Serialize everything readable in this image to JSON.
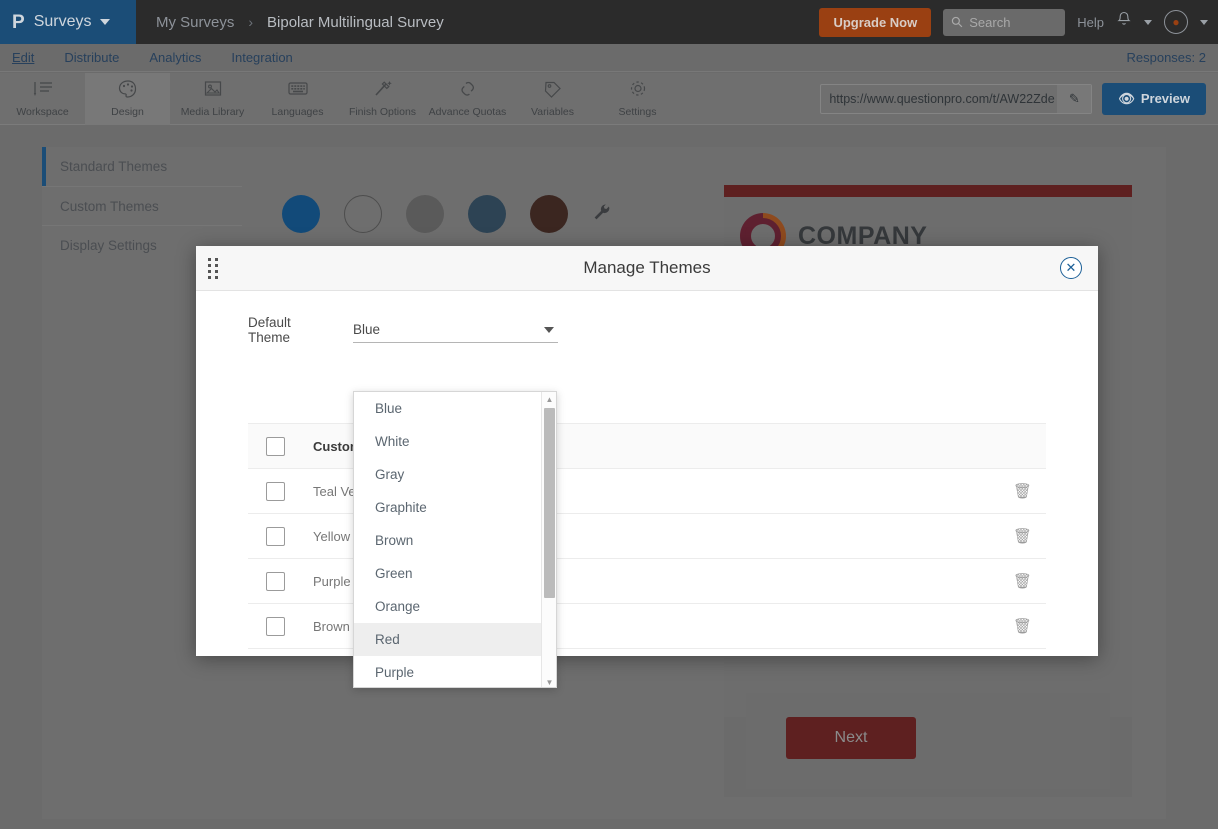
{
  "topbar": {
    "brand_logo": "P",
    "brand_label": "Surveys",
    "breadcrumb": [
      "My Surveys",
      "Bipolar Multilingual Survey"
    ],
    "breadcrumb_sep": "›",
    "upgrade_label": "Upgrade Now",
    "search_placeholder": "Search",
    "search_value": "",
    "help_label": "Help"
  },
  "navtabs": {
    "items": [
      {
        "label": "Edit",
        "active": true
      },
      {
        "label": "Distribute",
        "active": false
      },
      {
        "label": "Analytics",
        "active": false
      },
      {
        "label": "Integration",
        "active": false
      }
    ],
    "responses": "Responses: 2"
  },
  "toolbar": {
    "items": [
      {
        "label": "Workspace",
        "icon": "workspace-icon",
        "selected": false
      },
      {
        "label": "Design",
        "icon": "palette-icon",
        "selected": true
      },
      {
        "label": "Media Library",
        "icon": "image-icon",
        "selected": false
      },
      {
        "label": "Languages",
        "icon": "keyboard-icon",
        "selected": false
      },
      {
        "label": "Finish Options",
        "icon": "wand-icon",
        "selected": false
      },
      {
        "label": "Advance Quotas",
        "icon": "link-icon",
        "selected": false
      },
      {
        "label": "Variables",
        "icon": "tag-icon",
        "selected": false
      },
      {
        "label": "Settings",
        "icon": "gear-icon",
        "selected": false
      }
    ],
    "survey_url": "https://www.questionpro.com/t/AW22Zde",
    "preview_label": "Preview"
  },
  "sidebar": {
    "items": [
      {
        "label": "Standard Themes",
        "active": true
      },
      {
        "label": "Custom Themes",
        "active": false
      },
      {
        "label": "Display Settings",
        "active": false
      }
    ]
  },
  "theme_swatches": [
    {
      "name": "blue",
      "color": "#124a79"
    },
    {
      "name": "white",
      "color": "#6e6e6e"
    },
    {
      "name": "gray",
      "color": "#5a5a5a"
    },
    {
      "name": "graphite",
      "color": "#2d4354"
    },
    {
      "name": "brown",
      "color": "#3b2620"
    }
  ],
  "survey_preview": {
    "company_name": "COMPANY",
    "next_label": "Next",
    "accent": "#5e2020"
  },
  "modal": {
    "title": "Manage Themes",
    "close_label": "✕",
    "default_theme_label": "Default Theme",
    "default_theme_value": "Blue",
    "dropdown_options": [
      {
        "label": "Blue",
        "hover": false
      },
      {
        "label": "White",
        "hover": false
      },
      {
        "label": "Gray",
        "hover": false
      },
      {
        "label": "Graphite",
        "hover": false
      },
      {
        "label": "Brown",
        "hover": false
      },
      {
        "label": "Green",
        "hover": false
      },
      {
        "label": "Orange",
        "hover": false
      },
      {
        "label": "Red",
        "hover": true
      },
      {
        "label": "Purple",
        "hover": false
      }
    ],
    "table": {
      "rows": [
        {
          "name": "Custom Theme",
          "header": true,
          "deletable": false
        },
        {
          "name": "Teal Version",
          "header": false,
          "deletable": true
        },
        {
          "name": "Yellow",
          "header": false,
          "deletable": true
        },
        {
          "name": "Purple",
          "header": false,
          "deletable": true
        },
        {
          "name": "Brown",
          "header": false,
          "deletable": true
        }
      ],
      "trash_icon": "🗑"
    }
  }
}
